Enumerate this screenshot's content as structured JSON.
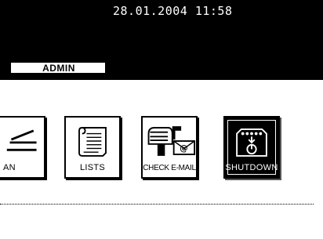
{
  "header": {
    "datetime": "28.01.2004 11:58"
  },
  "tabs": {
    "admin_label": "ADMIN"
  },
  "buttons": {
    "scan_label": "AN",
    "lists_label": "LISTS",
    "check_email_label": "CHECK E-MAIL",
    "shutdown_label": "SHUTDOWN"
  },
  "icons": {
    "scan": "scanner-icon",
    "lists": "document-list-icon",
    "check_email": "mailbox-icon",
    "shutdown": "power-off-icon"
  }
}
